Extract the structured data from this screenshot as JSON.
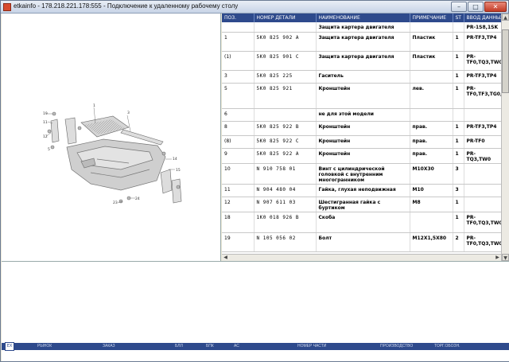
{
  "window": {
    "title": "etkainfo - 178.218.221.178:555 - Подключение к удаленному рабочему столу",
    "min": "–",
    "max": "□",
    "close": "✕"
  },
  "table": {
    "headers": [
      "ПОЗ.",
      "НОМЕР ДЕТАЛИ",
      "НАИМЕНОВАНИЕ",
      "ПРИМЕЧАНИЕ",
      "ST",
      "ВВОД ДАННЫХ"
    ],
    "rows": [
      {
        "pos": "",
        "part": "",
        "name": "Защита картера двигателя",
        "note": "",
        "st": "",
        "data": "PR-1S8,1SK"
      },
      {
        "pos": "1",
        "part": "5K0 825 902 A",
        "name": "Защита картера двигателя",
        "note": "Пластик",
        "st": "1",
        "data": "PR-TF3,TP4"
      },
      {
        "pos": "(1)",
        "part": "5K0 825 901 C",
        "name": "Защита картера двигателя",
        "note": "Пластик",
        "st": "1",
        "data": "PR-TF0,TQ3,TW0"
      },
      {
        "pos": "3",
        "part": "5K0 825 225",
        "name": "Гаситель",
        "note": "",
        "st": "1",
        "data": "PR-TF3,TP4"
      },
      {
        "pos": "5",
        "part": "5K0 825 921",
        "name": "Кронштейн",
        "note": "лев.",
        "st": "1",
        "data": "PR-TF0,TF3,TG0,TP4,TQ3,TW0"
      },
      {
        "pos": "6",
        "part": "",
        "name": "не для этой модели",
        "note": "",
        "st": "",
        "data": ""
      },
      {
        "pos": "8",
        "part": "5K0 825 922 B",
        "name": "Кронштейн",
        "note": "прав.",
        "st": "1",
        "data": "PR-TF3,TP4"
      },
      {
        "pos": "(8)",
        "part": "5K0 825 922 C",
        "name": "Кронштейн",
        "note": "прав.",
        "st": "1",
        "data": "PR-TF0"
      },
      {
        "pos": "9",
        "part": "5K0 825 922 A",
        "name": "Кронштейн",
        "note": "прав.",
        "st": "1",
        "data": "PR-TQ3,TW0"
      },
      {
        "pos": "10",
        "part": "N   910 758 01",
        "name": "Винт с цилиндрической головкой с внутренним многогранником",
        "note": "M10X30",
        "st": "3",
        "data": ""
      },
      {
        "pos": "11",
        "part": "N   904 480 04",
        "name": "Гайка, глухая неподвижная",
        "note": "M10",
        "st": "3",
        "data": ""
      },
      {
        "pos": "12",
        "part": "N   907 611 03",
        "name": "Шестигранная гайка с буртиком",
        "note": "M8",
        "st": "1",
        "data": ""
      },
      {
        "pos": "18",
        "part": "1K0 018 926 B",
        "name": "Скоба",
        "note": "",
        "st": "1",
        "data": "PR-TF0,TQ3,TW0"
      },
      {
        "pos": "19",
        "part": "N   105 056 02",
        "name": "Болт",
        "note": "M12X1,5X80",
        "st": "2",
        "data": "PR-TF0,TQ3,TW0"
      }
    ]
  },
  "diagram_labels": [
    "1",
    "3",
    "5",
    "6",
    "8",
    "9",
    "10",
    "11",
    "12",
    "14",
    "15",
    "16",
    "18",
    "19",
    "20",
    "23",
    "24"
  ],
  "status": {
    "exit": "EX",
    "items": [
      "РЫНОК",
      "ЗАКАЗ",
      "БЛЛ",
      "БПК",
      "АС",
      "НОМЕР ЧАСТИ",
      "ПРОИЗВОДСТВО",
      "ТОРГ.ОБОЗН."
    ]
  },
  "colors": {
    "header_bg": "#2e4a8c",
    "accent": "#d84a2e"
  }
}
